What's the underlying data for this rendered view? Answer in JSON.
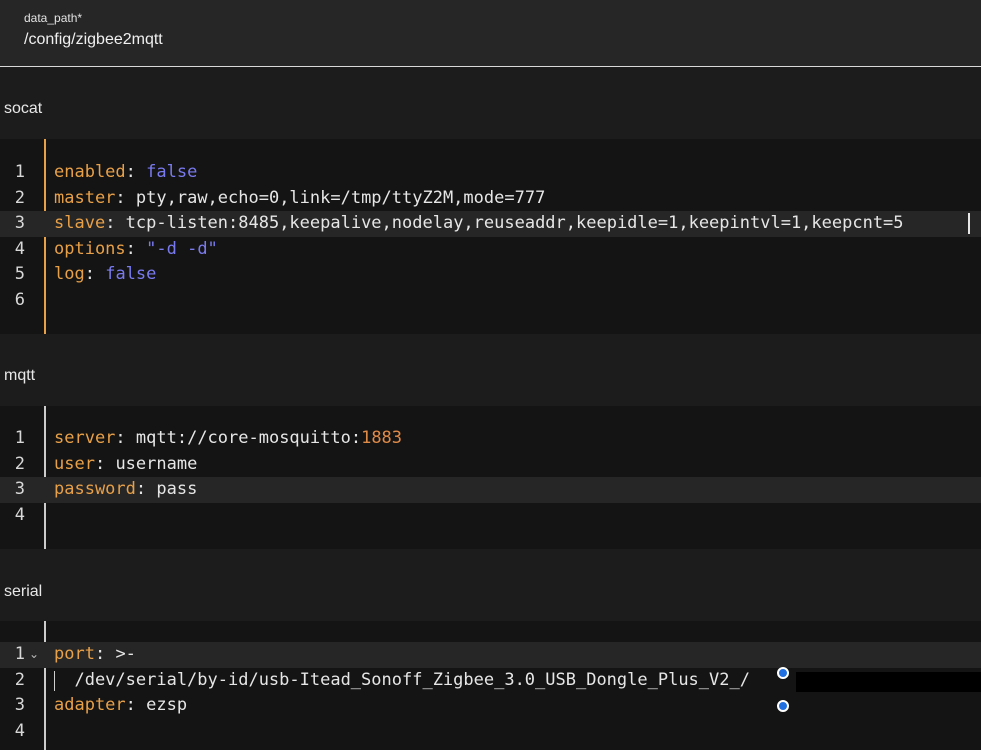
{
  "data_path": {
    "label": "data_path*",
    "value": "/config/zigbee2mqtt"
  },
  "sections": {
    "socat": {
      "title": "socat",
      "lines": [
        {
          "num": "1",
          "key": "enabled",
          "sep": ": ",
          "val": "false",
          "type": "b"
        },
        {
          "num": "2",
          "key": "master",
          "sep": ": ",
          "val": "pty,raw,echo=0,link=/tmp/ttyZ2M,mode=777",
          "type": "p"
        },
        {
          "num": "3",
          "key": "slave",
          "sep": ": ",
          "val": "tcp-listen:8485,keepalive,nodelay,reuseaddr,keepidle=1,keepintvl=1,keepcnt=5",
          "type": "p"
        },
        {
          "num": "4",
          "key": "options",
          "sep": ": ",
          "val": "\"-d -d\"",
          "type": "s"
        },
        {
          "num": "5",
          "key": "log",
          "sep": ": ",
          "val": "false",
          "type": "b"
        },
        {
          "num": "6",
          "key": "",
          "sep": "",
          "val": "",
          "type": "p"
        }
      ]
    },
    "mqtt": {
      "title": "mqtt",
      "lines": [
        {
          "num": "1",
          "key": "server",
          "sep": ": ",
          "val": "mqtt://core-mosquitto:",
          "val2": "1883",
          "type": "p"
        },
        {
          "num": "2",
          "key": "user",
          "sep": ": ",
          "val": "username",
          "type": "p"
        },
        {
          "num": "3",
          "key": "password",
          "sep": ": ",
          "val": "pass",
          "type": "p"
        },
        {
          "num": "4",
          "key": "",
          "sep": "",
          "val": "",
          "type": "p"
        }
      ]
    },
    "serial": {
      "title": "serial",
      "lines": [
        {
          "num": "1",
          "key": "port",
          "sep": ": ",
          "val": ">-",
          "type": "p"
        },
        {
          "num": "2",
          "key": "",
          "sep": "",
          "val": "  /dev/serial/by-id/usb-Itead_Sonoff_Zigbee_3.0_USB_Dongle_Plus_V2_/",
          "type": "p"
        },
        {
          "num": "3",
          "key": "adapter",
          "sep": ": ",
          "val": "ezsp",
          "type": "p"
        },
        {
          "num": "4",
          "key": "",
          "sep": "",
          "val": "",
          "type": "p"
        }
      ]
    }
  },
  "colors": {
    "key": "#e8a048",
    "boolean": "#7a7aef",
    "number": "#e08a48",
    "focus_gutter": "#e8a048",
    "selection_handle": "#1f6fe0"
  },
  "icons": {
    "fold": "⌄"
  }
}
